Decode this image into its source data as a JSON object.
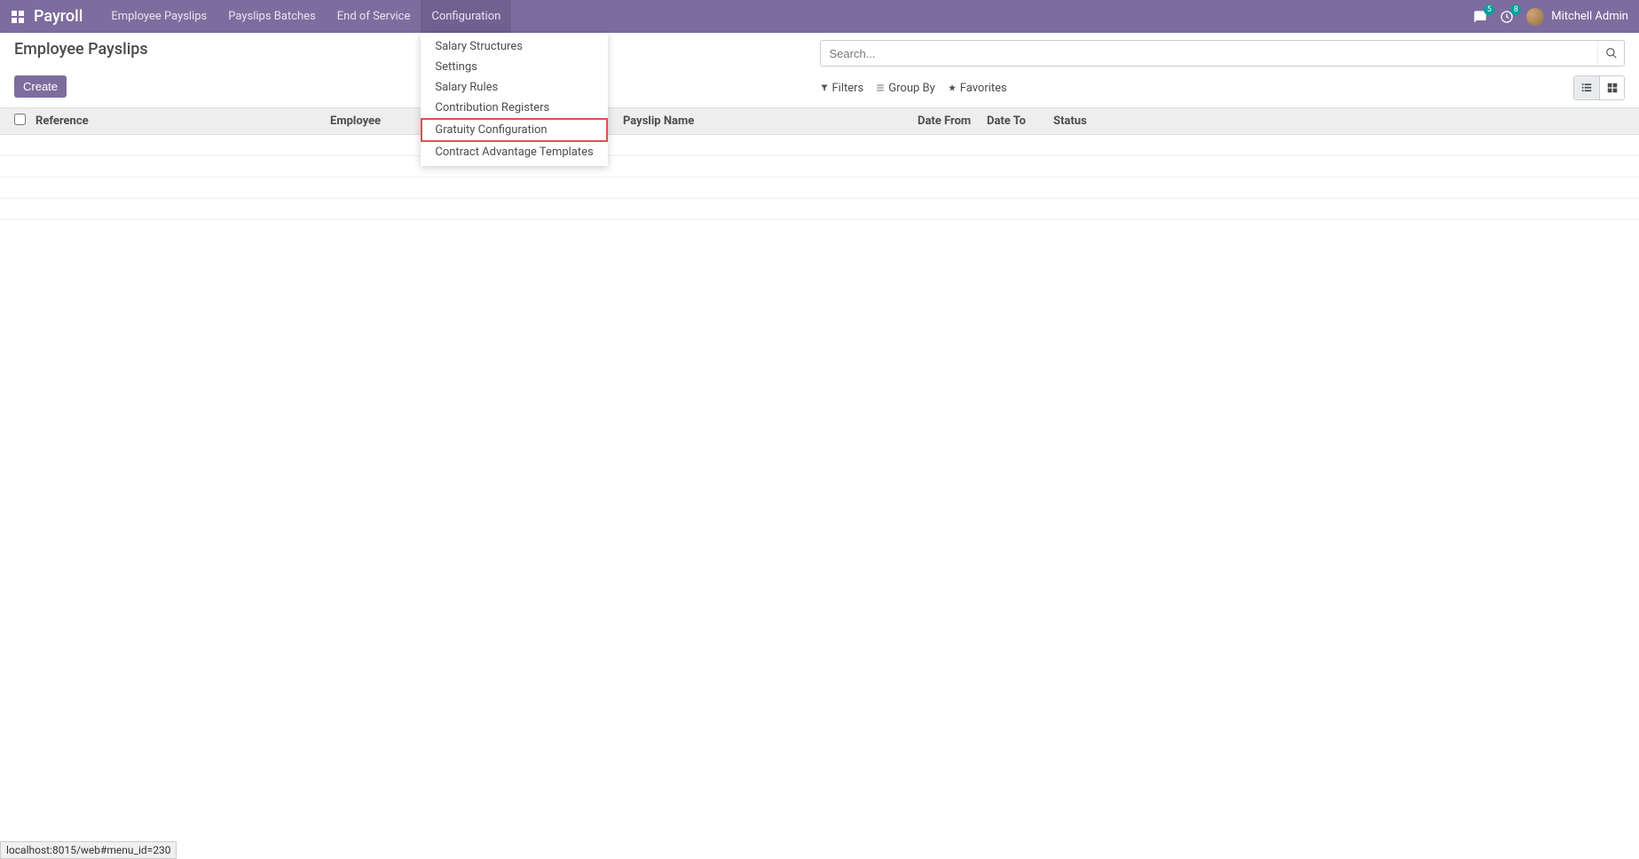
{
  "topbar": {
    "brand": "Payroll",
    "menu": [
      {
        "label": "Employee Payslips"
      },
      {
        "label": "Payslips Batches"
      },
      {
        "label": "End of Service"
      },
      {
        "label": "Configuration"
      }
    ],
    "config_submenu": [
      {
        "label": "Salary Structures"
      },
      {
        "label": "Settings"
      },
      {
        "label": "Salary Rules"
      },
      {
        "label": "Contribution Registers"
      },
      {
        "label": "Gratuity Configuration"
      },
      {
        "label": "Contract Advantage Templates"
      }
    ],
    "messages_badge": "5",
    "activities_badge": "8",
    "username": "Mitchell Admin"
  },
  "page": {
    "title": "Employee Payslips",
    "create_label": "Create",
    "search_placeholder": "Search...",
    "filters_label": "Filters",
    "groupby_label": "Group By",
    "favorites_label": "Favorites"
  },
  "table": {
    "columns": {
      "reference": "Reference",
      "employee": "Employee",
      "payslip": "Payslip Name",
      "datefrom": "Date From",
      "dateto": "Date To",
      "status": "Status"
    }
  },
  "statusbar": "localhost:8015/web#menu_id=230"
}
